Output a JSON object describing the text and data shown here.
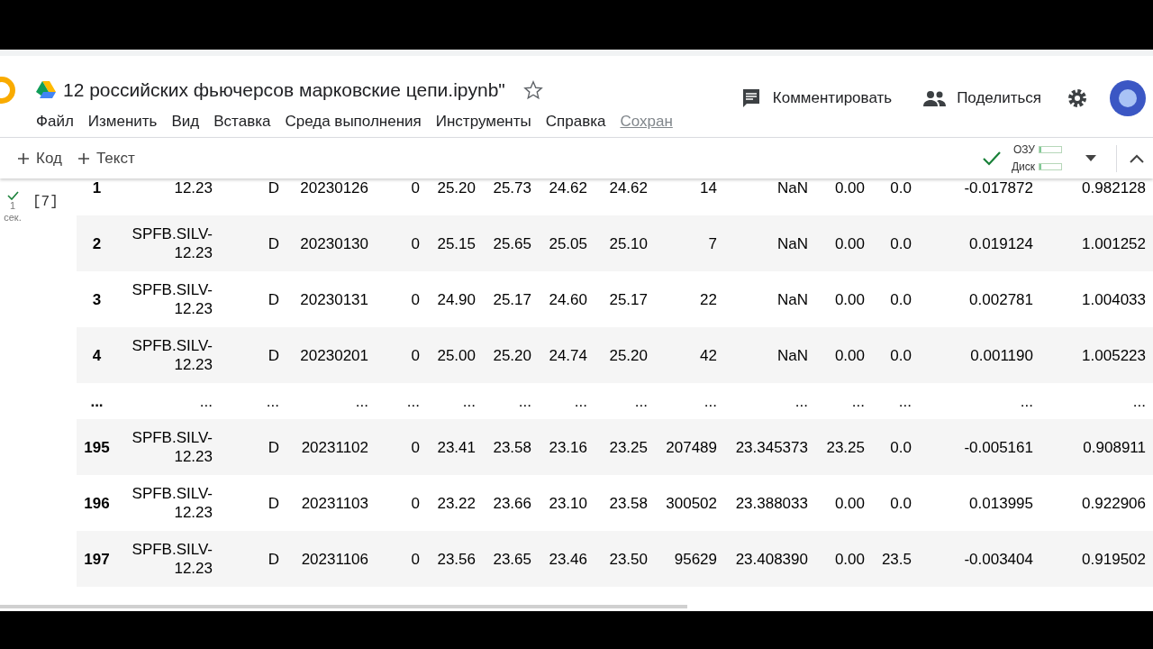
{
  "header": {
    "title": "12 российских фьючерсов марковские цепи.ipynb\"",
    "starred": false,
    "menu": [
      {
        "label": "Файл",
        "kind": "menu"
      },
      {
        "label": "Изменить",
        "kind": "menu"
      },
      {
        "label": "Вид",
        "kind": "menu"
      },
      {
        "label": "Вставка",
        "kind": "menu"
      },
      {
        "label": "Среда выполнения",
        "kind": "menu"
      },
      {
        "label": "Инструменты",
        "kind": "menu"
      },
      {
        "label": "Справка",
        "kind": "menu"
      },
      {
        "label": "Сохран",
        "kind": "status"
      }
    ],
    "comment": "Комментировать",
    "share": "Поделиться"
  },
  "toolbar": {
    "add_code": "Код",
    "add_text": "Текст",
    "connected": true,
    "ram": {
      "label": "ОЗУ",
      "level": 0.1
    },
    "disk": {
      "label": "Диск",
      "level": 0.1
    }
  },
  "cell": {
    "execution_count": "[7]",
    "duration": "1",
    "duration_unit": "сек.",
    "succeeded": true
  },
  "table": {
    "rows": [
      {
        "kind": "data",
        "cells": [
          "1",
          "12.23",
          "D",
          "20230126",
          "0",
          "25.20",
          "25.73",
          "24.62",
          "24.62",
          "14",
          "NaN",
          "0.00",
          "0.0",
          "-0.017872",
          "0.982128"
        ]
      },
      {
        "kind": "data",
        "cells": [
          "2",
          "SPFB.SILV-12.23",
          "D",
          "20230130",
          "0",
          "25.15",
          "25.65",
          "25.05",
          "25.10",
          "7",
          "NaN",
          "0.00",
          "0.0",
          "0.019124",
          "1.001252"
        ]
      },
      {
        "kind": "data",
        "cells": [
          "3",
          "SPFB.SILV-12.23",
          "D",
          "20230131",
          "0",
          "24.90",
          "25.17",
          "24.60",
          "25.17",
          "22",
          "NaN",
          "0.00",
          "0.0",
          "0.002781",
          "1.004033"
        ]
      },
      {
        "kind": "data",
        "cells": [
          "4",
          "SPFB.SILV-12.23",
          "D",
          "20230201",
          "0",
          "25.00",
          "25.20",
          "24.74",
          "25.20",
          "42",
          "NaN",
          "0.00",
          "0.0",
          "0.001190",
          "1.005223"
        ]
      },
      {
        "kind": "ellipsis",
        "cells": [
          "...",
          "...",
          "...",
          "...",
          "...",
          "...",
          "...",
          "...",
          "...",
          "...",
          "...",
          "...",
          "...",
          "...",
          "..."
        ]
      },
      {
        "kind": "data",
        "cells": [
          "195",
          "SPFB.SILV-12.23",
          "D",
          "20231102",
          "0",
          "23.41",
          "23.58",
          "23.16",
          "23.25",
          "207489",
          "23.345373",
          "23.25",
          "0.0",
          "-0.005161",
          "0.908911"
        ]
      },
      {
        "kind": "data",
        "cells": [
          "196",
          "SPFB.SILV-12.23",
          "D",
          "20231103",
          "0",
          "23.22",
          "23.66",
          "23.10",
          "23.58",
          "300502",
          "23.388033",
          "0.00",
          "0.0",
          "0.013995",
          "0.922906"
        ]
      },
      {
        "kind": "data",
        "cells": [
          "197",
          "SPFB.SILV-12.23",
          "D",
          "20231106",
          "0",
          "23.56",
          "23.65",
          "23.46",
          "23.50",
          "95629",
          "23.408390",
          "0.00",
          "23.5",
          "-0.003404",
          "0.919502"
        ]
      }
    ]
  }
}
